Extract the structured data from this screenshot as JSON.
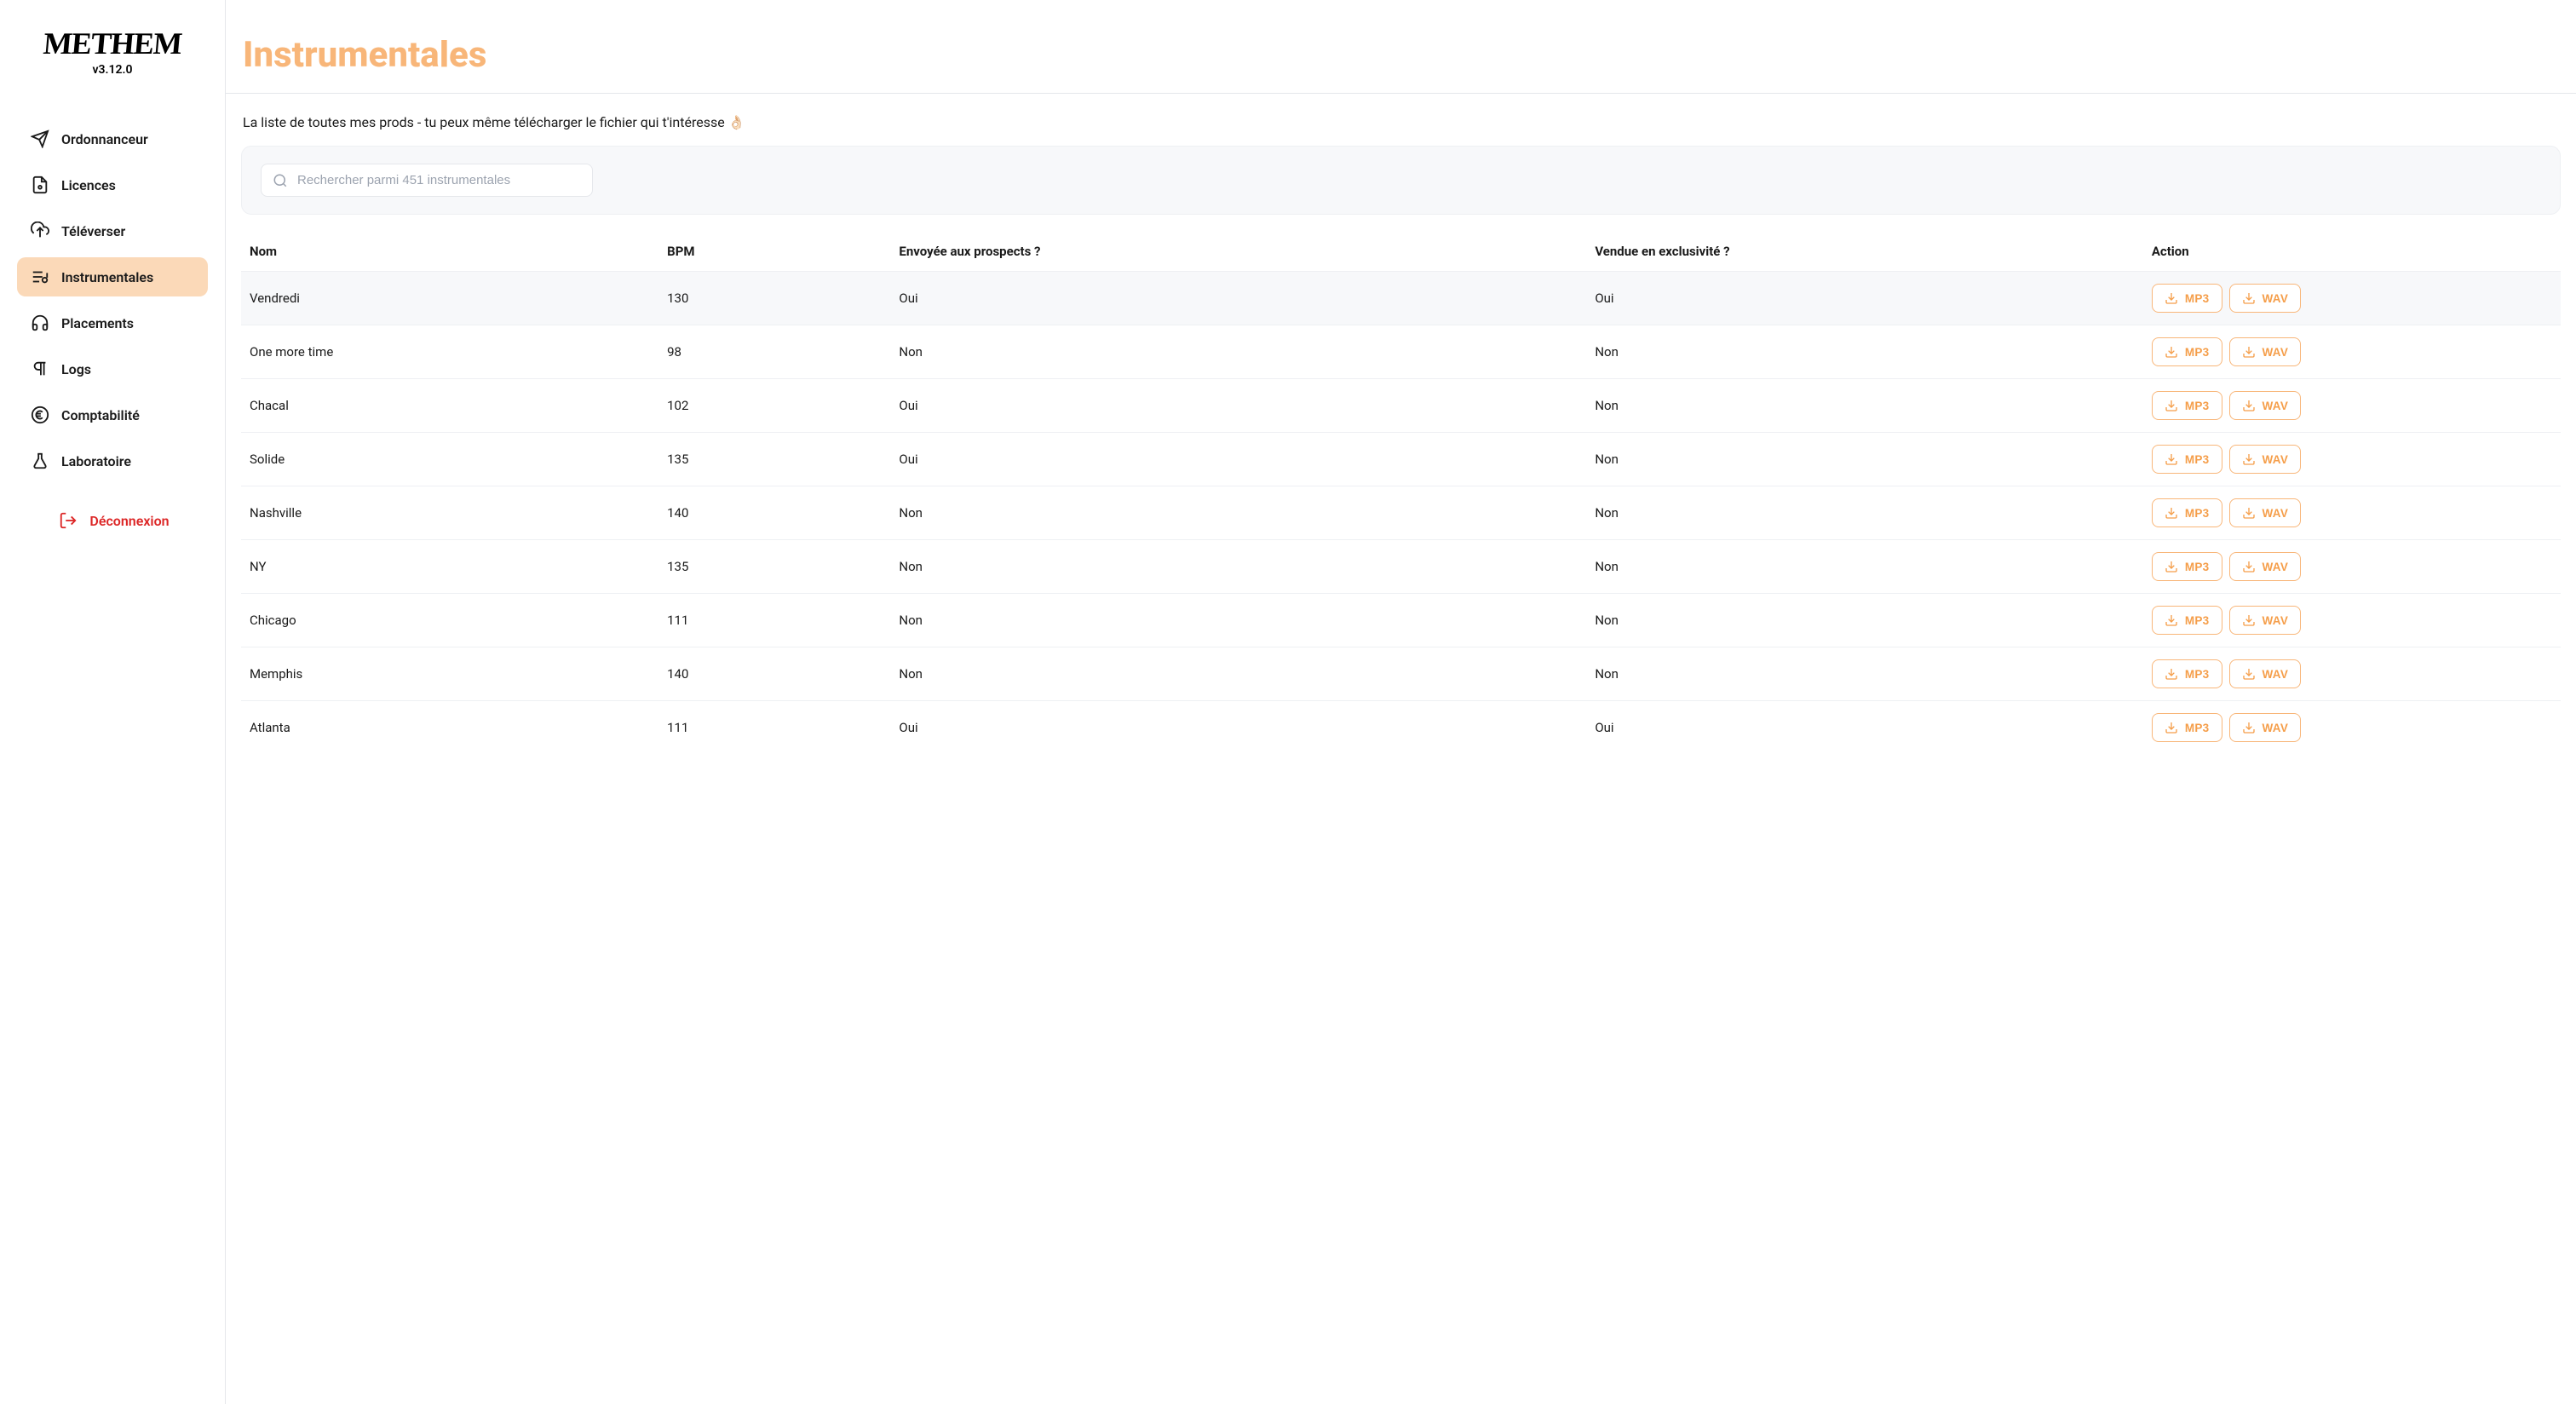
{
  "app": {
    "name": "METHEM",
    "version": "v3.12.0"
  },
  "sidebar": {
    "items": [
      {
        "label": "Ordonnanceur",
        "icon": "send",
        "active": false
      },
      {
        "label": "Licences",
        "icon": "file-badge",
        "active": false
      },
      {
        "label": "Téléverser",
        "icon": "cloud-upload",
        "active": false
      },
      {
        "label": "Instrumentales",
        "icon": "playlist",
        "active": true
      },
      {
        "label": "Placements",
        "icon": "headphones",
        "active": false
      },
      {
        "label": "Logs",
        "icon": "paragraph",
        "active": false
      },
      {
        "label": "Comptabilité",
        "icon": "euro",
        "active": false
      },
      {
        "label": "Laboratoire",
        "icon": "flask",
        "active": false
      }
    ],
    "logout_label": "Déconnexion"
  },
  "page": {
    "title": "Instrumentales",
    "subtitle": "La liste de toutes mes prods - tu peux même télécharger le fichier qui t'intéresse 👌🏻"
  },
  "search": {
    "placeholder": "Rechercher parmi 451 instrumentales",
    "value": ""
  },
  "table": {
    "headers": {
      "name": "Nom",
      "bpm": "BPM",
      "sent": "Envoyée aux prospects ?",
      "sold": "Vendue en exclusivité ?",
      "action": "Action"
    },
    "action_labels": {
      "mp3": "MP3",
      "wav": "WAV"
    },
    "rows": [
      {
        "name": "Vendredi",
        "bpm": "130",
        "sent": "Oui",
        "sold": "Oui"
      },
      {
        "name": "One more time",
        "bpm": "98",
        "sent": "Non",
        "sold": "Non"
      },
      {
        "name": "Chacal",
        "bpm": "102",
        "sent": "Oui",
        "sold": "Non"
      },
      {
        "name": "Solide",
        "bpm": "135",
        "sent": "Oui",
        "sold": "Non"
      },
      {
        "name": "Nashville",
        "bpm": "140",
        "sent": "Non",
        "sold": "Non"
      },
      {
        "name": "NY",
        "bpm": "135",
        "sent": "Non",
        "sold": "Non"
      },
      {
        "name": "Chicago",
        "bpm": "111",
        "sent": "Non",
        "sold": "Non"
      },
      {
        "name": "Memphis",
        "bpm": "140",
        "sent": "Non",
        "sold": "Non"
      },
      {
        "name": "Atlanta",
        "bpm": "111",
        "sent": "Oui",
        "sold": "Oui"
      }
    ]
  },
  "colors": {
    "accent": "#f8b679",
    "accent_text": "#f59e4a",
    "nav_active_bg": "#fbd9b8",
    "danger": "#dc2626"
  }
}
